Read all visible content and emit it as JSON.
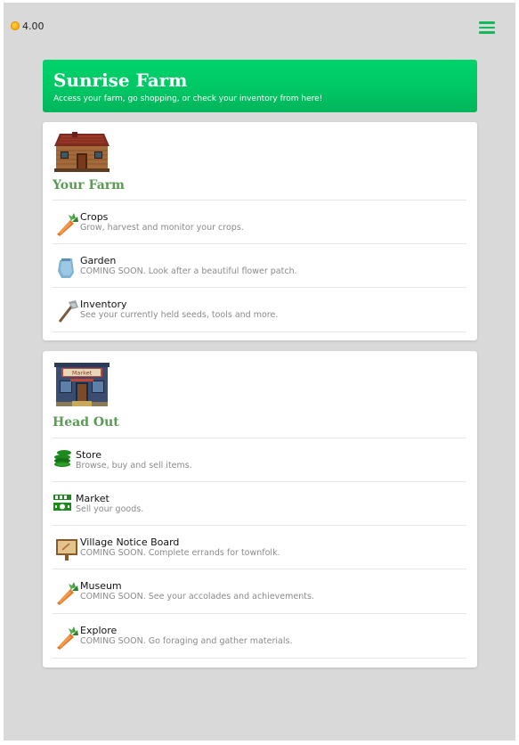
{
  "topbar": {
    "coins": "4.00",
    "menu_icon": "hamburger-menu-icon"
  },
  "banner": {
    "title": "Sunrise Farm",
    "subtitle": "Access your farm, go shopping, or check your inventory from here!"
  },
  "farm": {
    "image": "farmhouse-image",
    "title": "Your Farm",
    "items": [
      {
        "name": "Crops",
        "desc": "Grow, harvest and monitor your crops.",
        "icon": "carrot-icon"
      },
      {
        "name": "Garden",
        "desc": "COMING SOON. Look after a beautiful flower patch.",
        "icon": "watering-can-icon"
      },
      {
        "name": "Inventory",
        "desc": "See your currently held seeds, tools and more.",
        "icon": "axe-icon"
      }
    ]
  },
  "headout": {
    "image": "market-building-image",
    "sign_text": "Market",
    "title": "Head Out",
    "items": [
      {
        "name": "Store",
        "desc": "Browse, buy and sell items.",
        "icon": "coins-stack-icon"
      },
      {
        "name": "Market",
        "desc": "Sell your goods.",
        "icon": "money-icon"
      },
      {
        "name": "Village Notice Board",
        "desc": "COMING SOON. Complete errands for townfolk.",
        "icon": "notice-board-icon"
      },
      {
        "name": "Museum",
        "desc": "COMING SOON. See your accolades and achievements.",
        "icon": "carrot-icon"
      },
      {
        "name": "Explore",
        "desc": "COMING SOON. Go foraging and gather materials.",
        "icon": "carrot-icon"
      }
    ]
  },
  "colors": {
    "accent_green": "#00c765",
    "section_title": "#5a9a55",
    "icon_green": "#1d8a1d"
  }
}
